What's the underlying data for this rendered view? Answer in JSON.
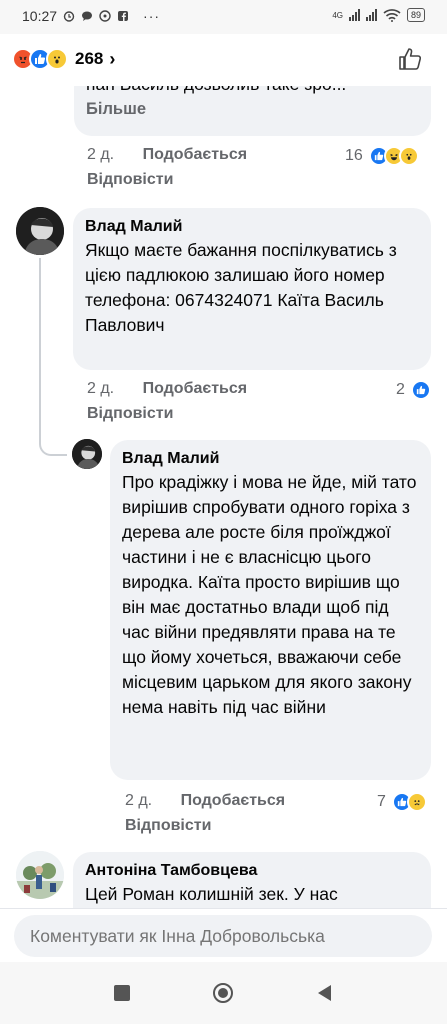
{
  "status_bar": {
    "time": "10:27",
    "ellipsis": "···",
    "network": "4G",
    "battery": "89"
  },
  "header": {
    "reaction_count": "268",
    "chevron": "›",
    "reaction_icons": [
      "angry-icon",
      "like-icon",
      "wow-icon"
    ]
  },
  "comments": [
    {
      "text_lines": [
        "пан Василь дозволив таке зро...",
        "Більше"
      ],
      "age": "2 д.",
      "like_label": "Подобається",
      "reply_label": "Відповісти",
      "reaction_count": "16"
    },
    {
      "author": "Влад Малий",
      "text": "Якщо маєте бажання поспілкуватись з цією падлюкою залишаю його номер телефона: 0674324071 Каїта Василь Павлович",
      "age": "2 д.",
      "like_label": "Подобається",
      "reply_label": "Відповісти",
      "reaction_count": "2"
    },
    {
      "author": "Влад Малий",
      "text": "Про крадіжку і мова не йде, мій тато вирішив спробувати одного горіха з дерева але росте біля проїжджої частини і не є власнісцю цього виродка. Каїта просто вирішив що він має достатньо влади щоб під час війни предявляти права на те що йому хочеться, вважаючи себе місцевим царьком для якого закону нема навіть під час війни",
      "age": "2 д.",
      "like_label": "Подобається",
      "reply_label": "Відповісти",
      "reaction_count": "7"
    },
    {
      "author": "Антоніна Тамбовцева",
      "text": "Цей Роман колишній зек. У нас"
    }
  ],
  "composer": {
    "placeholder": "Коментувати як Інна Добровольська"
  },
  "colors": {
    "like_blue": "#1877f2",
    "meta_gray": "#65676b",
    "bubble_bg": "#f0f2f5"
  }
}
